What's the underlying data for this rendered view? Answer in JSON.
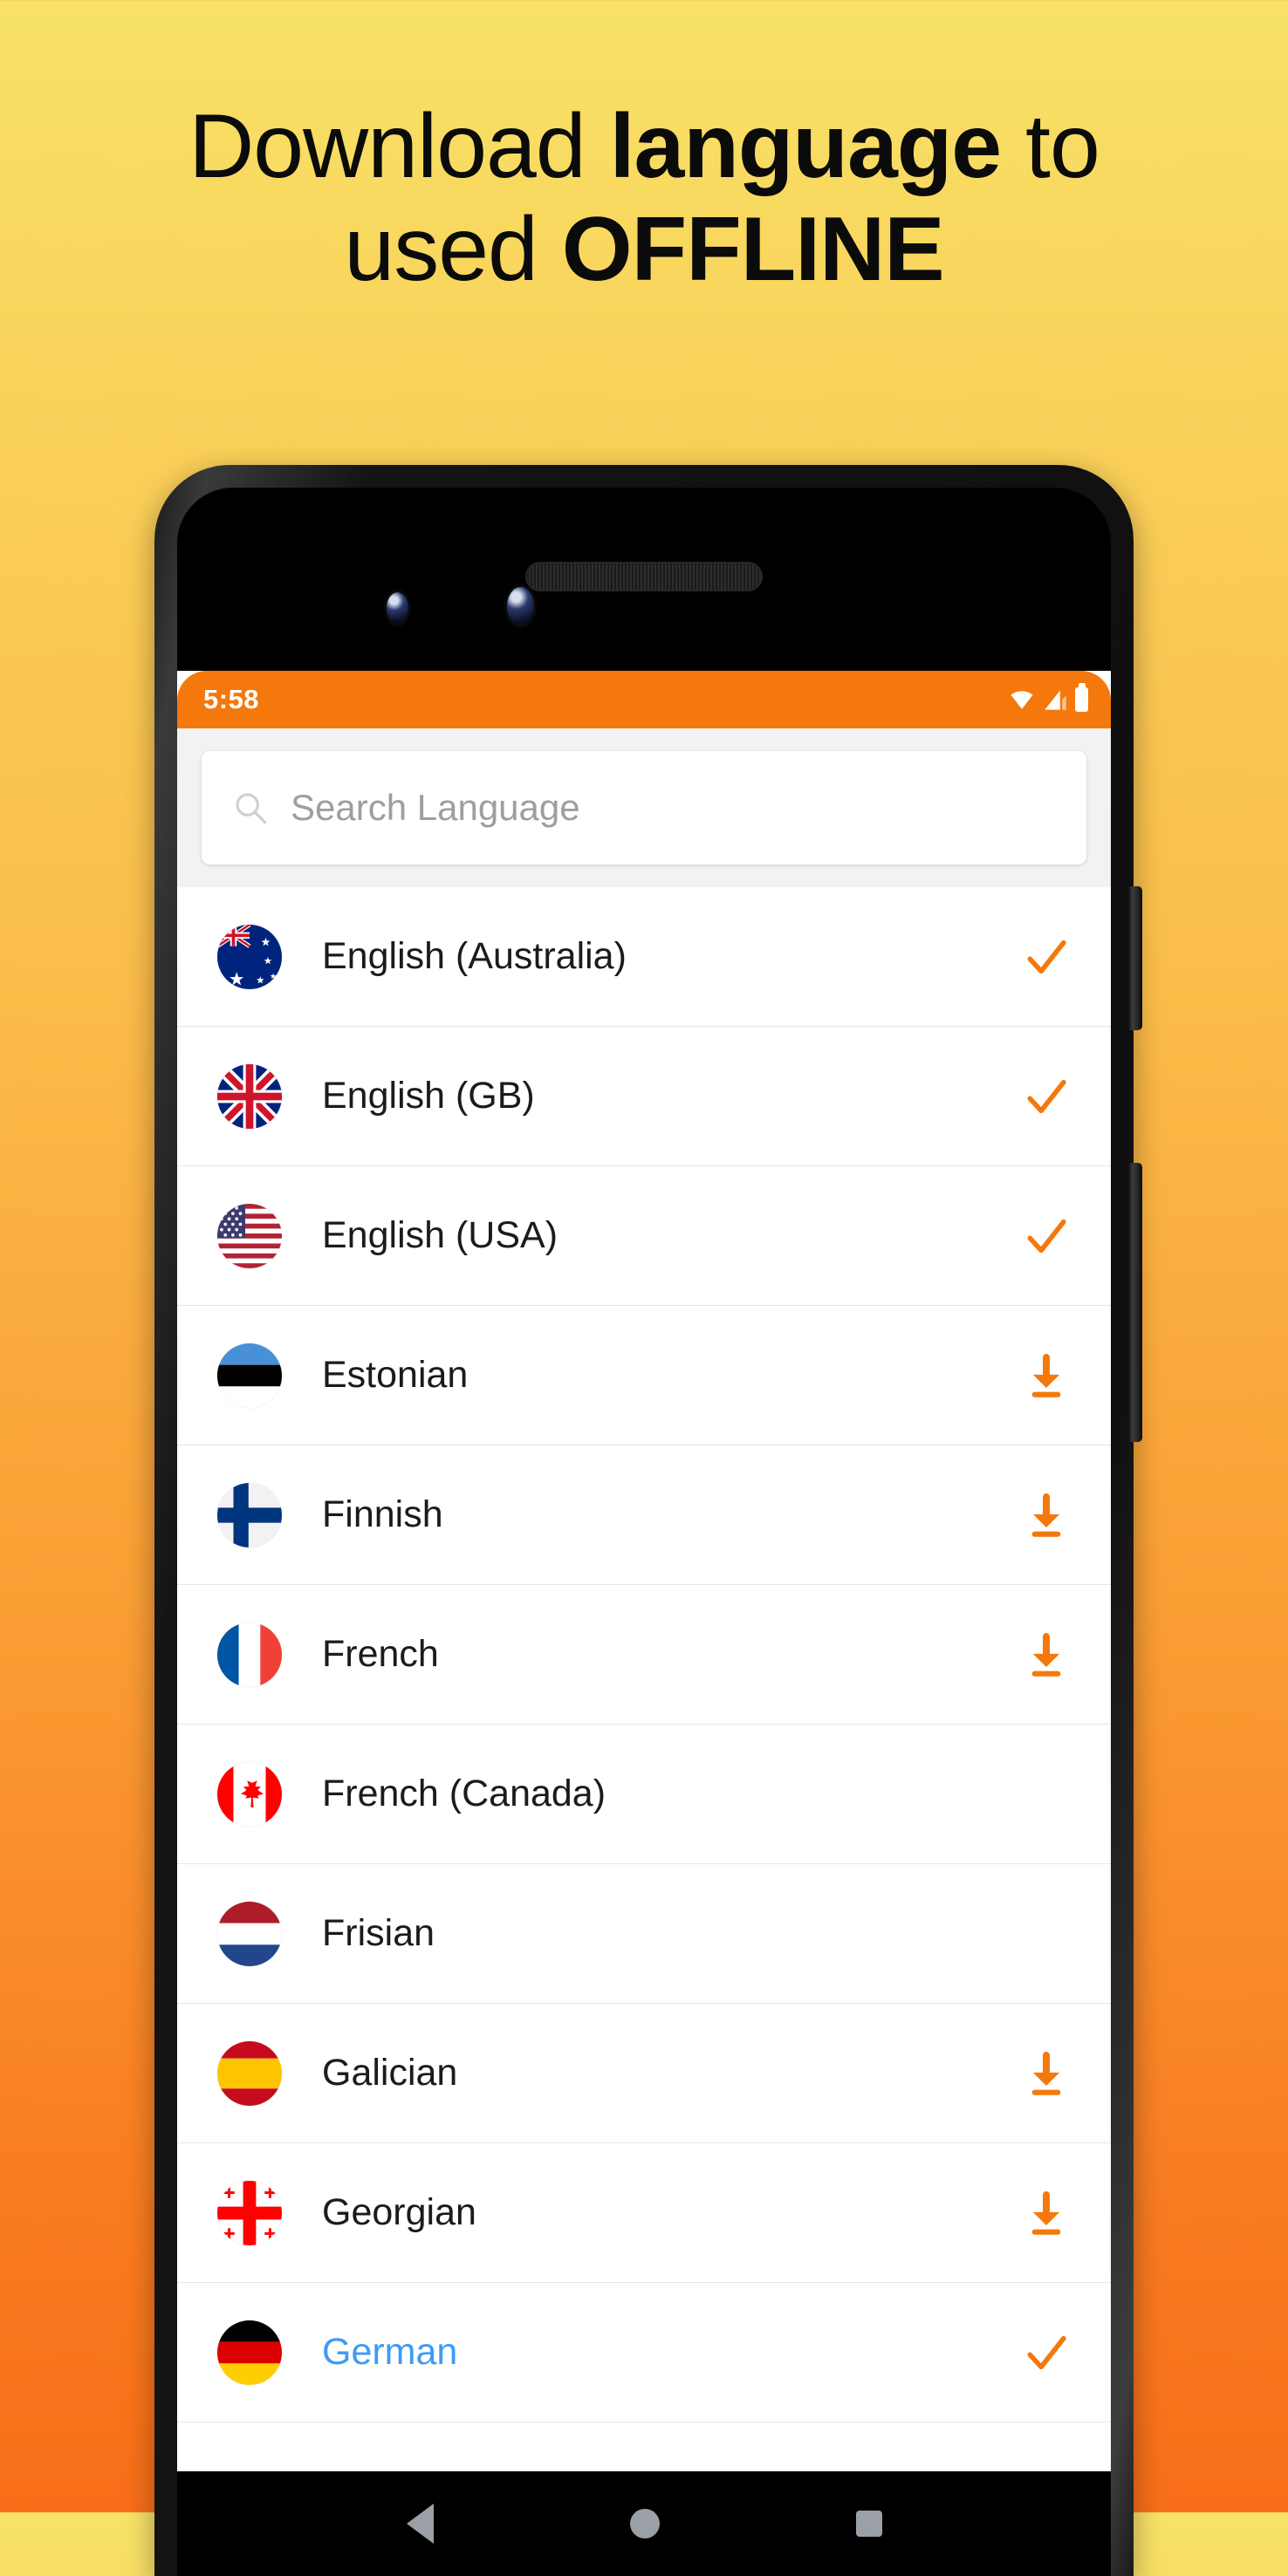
{
  "promo": {
    "headline_line1": [
      {
        "text": "Download ",
        "bold": false
      },
      {
        "text": "language",
        "bold": true
      },
      {
        "text": " to",
        "bold": false
      }
    ],
    "headline_line2": [
      {
        "text": "used ",
        "bold": false
      },
      {
        "text": "OFFLINE",
        "bold": true
      }
    ],
    "headline_plain": "Download language to used OFFLINE",
    "background_top_color": "#F8E268",
    "background_bottom_color": "#F86E18"
  },
  "device": {
    "frame_color": "#1a1a1a",
    "buttons": [
      {
        "name": "power-button"
      },
      {
        "name": "volume-rocker"
      }
    ],
    "sensors": [
      "front-camera-1",
      "front-camera-2",
      "earpiece-speaker"
    ]
  },
  "statusbar": {
    "time": "5:58",
    "background_color": "#F4780B",
    "icons": [
      "wifi-icon",
      "signal-icon",
      "battery-icon"
    ]
  },
  "search": {
    "placeholder": "Search Language",
    "value": "",
    "icon": "search-icon"
  },
  "list": {
    "accent_color": "#F4780B",
    "selected_text_color": "#3e9bf3",
    "items": [
      {
        "label": "English (Australia)",
        "flag": "au",
        "action": "check",
        "selected": false
      },
      {
        "label": "English (GB)",
        "flag": "gb",
        "action": "check",
        "selected": false
      },
      {
        "label": "English (USA)",
        "flag": "us",
        "action": "check",
        "selected": false
      },
      {
        "label": "Estonian",
        "flag": "ee",
        "action": "download",
        "selected": false
      },
      {
        "label": "Finnish",
        "flag": "fi",
        "action": "download",
        "selected": false
      },
      {
        "label": "French",
        "flag": "fr",
        "action": "download",
        "selected": false
      },
      {
        "label": "French (Canada)",
        "flag": "ca",
        "action": "none",
        "selected": false
      },
      {
        "label": "Frisian",
        "flag": "nl",
        "action": "none",
        "selected": false
      },
      {
        "label": "Galician",
        "flag": "es",
        "action": "download",
        "selected": false
      },
      {
        "label": "Georgian",
        "flag": "ge",
        "action": "download",
        "selected": false
      },
      {
        "label": "German",
        "flag": "de",
        "action": "check",
        "selected": true
      }
    ]
  },
  "navbar": {
    "buttons": [
      {
        "name": "back-button",
        "icon": "triangle-left-icon"
      },
      {
        "name": "home-button",
        "icon": "circle-icon"
      },
      {
        "name": "recents-button",
        "icon": "square-icon"
      }
    ],
    "icon_color": "#9aa0a6"
  }
}
